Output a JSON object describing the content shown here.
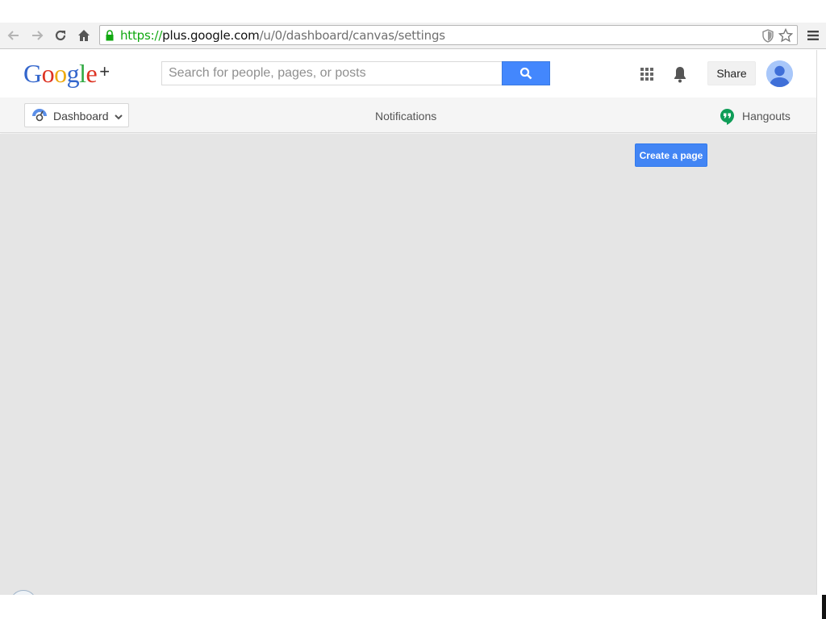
{
  "browser": {
    "url_scheme": "https://",
    "url_host": "plus.google.com",
    "url_path": "/u/0/dashboard/canvas/settings"
  },
  "header": {
    "logo": {
      "letters": [
        "G",
        "o",
        "o",
        "g",
        "l",
        "e"
      ],
      "colors": [
        "#3366cc",
        "#dd3322",
        "#eeaa11",
        "#3366cc",
        "#33aa44",
        "#dd3322"
      ],
      "plus": "+"
    },
    "search": {
      "placeholder": "Search for people, pages, or posts",
      "value": ""
    },
    "share_label": "Share"
  },
  "nav": {
    "dashboard_label": "Dashboard",
    "notifications_label": "Notifications",
    "hangouts_label": "Hangouts"
  },
  "main": {
    "create_page_label": "Create a page"
  },
  "colors": {
    "accent_blue": "#4285f4",
    "hangouts_green": "#0f9d58",
    "main_background": "#e5e5e5"
  },
  "icons": {
    "back": "arrow-left-icon",
    "forward": "arrow-right-icon",
    "reload": "reload-icon",
    "home": "home-icon",
    "lock": "lock-icon",
    "shield": "shield-icon",
    "star": "star-icon",
    "menu": "hamburger-menu-icon",
    "search": "search-icon",
    "apps": "apps-grid-icon",
    "notifications": "bell-icon",
    "avatar": "user-avatar",
    "dashboard": "dashboard-gauge-icon",
    "chevron": "chevron-down-icon",
    "hangouts": "hangouts-icon"
  }
}
